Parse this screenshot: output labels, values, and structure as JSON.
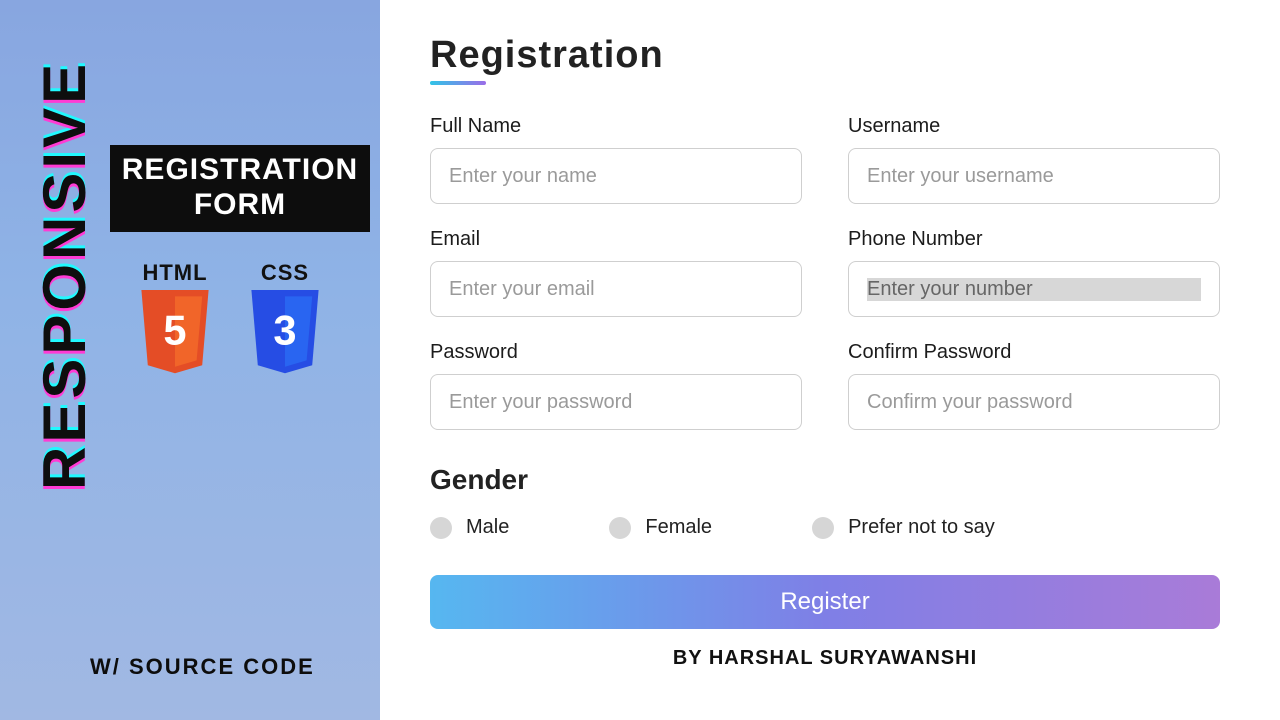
{
  "left": {
    "responsive": "RESPONSIVE",
    "box_line1": "REGISTRATION",
    "box_line2": "FORM",
    "html_label": "HTML",
    "css_label": "CSS",
    "source": "W/ SOURCE CODE"
  },
  "form": {
    "title": "Registration",
    "fields": {
      "fullname": {
        "label": "Full Name",
        "placeholder": "Enter your name"
      },
      "username": {
        "label": "Username",
        "placeholder": "Enter your username"
      },
      "email": {
        "label": "Email",
        "placeholder": "Enter your email"
      },
      "phone": {
        "label": "Phone Number",
        "placeholder": "Enter your number"
      },
      "password": {
        "label": "Password",
        "placeholder": "Enter your password"
      },
      "confirm": {
        "label": "Confirm Password",
        "placeholder": "Confirm your password"
      }
    },
    "gender": {
      "title": "Gender",
      "options": [
        "Male",
        "Female",
        "Prefer not to say"
      ]
    },
    "submit": "Register",
    "byline": "BY HARSHAL SURYAWANSHI"
  }
}
